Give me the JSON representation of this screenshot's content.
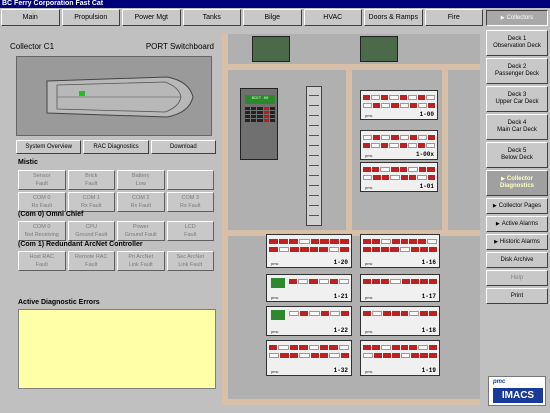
{
  "window": {
    "title": "BC Ferry Corporation Fast Cat"
  },
  "topnav": [
    "Main",
    "Propulsion",
    "Power Mgt",
    "Tanks",
    "Bilge",
    "HVAC",
    "Doors & Ramps",
    "Fire"
  ],
  "collector": {
    "name": "Collector C1",
    "switchboard": "PORT Switchboard"
  },
  "actions": [
    "System Overview",
    "RAC Diagnostics",
    "Download"
  ],
  "mistic": {
    "title": "Mistic",
    "faults": [
      [
        "Sensor",
        "Fault"
      ],
      [
        "Brick",
        "Fault"
      ],
      [
        "Battery",
        "Low"
      ],
      [
        "",
        ""
      ],
      [
        "COM 0",
        "Rx Fault"
      ],
      [
        "COM 1",
        "Rx Fault"
      ],
      [
        "COM 2",
        "Rx Fault"
      ],
      [
        "COM 3",
        "Rx Fault"
      ]
    ]
  },
  "omni": {
    "title": "(Com 0) Omni Chief",
    "faults": [
      [
        "COM 0",
        "Not Receiving"
      ],
      [
        "CPU",
        "Ground Fault"
      ],
      [
        "Power",
        "Ground Fault"
      ],
      [
        "LCD",
        "Fault"
      ]
    ]
  },
  "arcnet": {
    "title": "(Com 1) Redundant ArcNet Controller",
    "faults": [
      [
        "Host RAC",
        "Fault"
      ],
      [
        "Remote RAC",
        "Fault"
      ],
      [
        "Pri ArcNet",
        "Link Fault"
      ],
      [
        "Sec ArcNet",
        "Link Fault"
      ]
    ]
  },
  "errors": {
    "title": "Active Diagnostic Errors"
  },
  "diagram": {
    "controller_screen": "BCET 00",
    "rack_labels": [
      "1-00",
      "1-00x",
      "1-01",
      "1-20",
      "1-16",
      "1-21",
      "1-17",
      "1-22",
      "1-18",
      "1-32",
      "1-19"
    ],
    "rack_brand": "pmc"
  },
  "sidebar": {
    "collectors": "Collectors",
    "decks": [
      [
        "Deck 1",
        "Observation Deck"
      ],
      [
        "Deck 2",
        "Passenger Deck"
      ],
      [
        "Deck 3",
        "Upper Car Deck"
      ],
      [
        "Deck 4",
        "Main Car Deck"
      ],
      [
        "Deck 5",
        "Below Deck"
      ]
    ],
    "diagnostics": [
      "Collector",
      "Diagnostics"
    ],
    "collector_pages": "Collector Pages",
    "active_alarms": "Active Alarms",
    "historic_alarms": "Historic Alarms",
    "disk_archive": "Disk Archive",
    "help": "Help",
    "print": "Print"
  },
  "logo": {
    "top": "pmc",
    "main": "IMACS"
  },
  "colors": {
    "title_bar": "#00007b",
    "error_box": "#ffffa8",
    "logo_blue": "#1a3a9a"
  }
}
